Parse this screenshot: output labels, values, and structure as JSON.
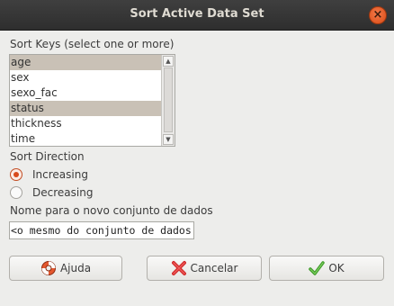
{
  "window": {
    "title": "Sort Active Data Set",
    "close_glyph": "×"
  },
  "sort_keys": {
    "label": "Sort Keys (select one or more)",
    "items": [
      {
        "label": "age",
        "selected": true
      },
      {
        "label": "sex",
        "selected": false
      },
      {
        "label": "sexo_fac",
        "selected": false
      },
      {
        "label": "status",
        "selected": true
      },
      {
        "label": "thickness",
        "selected": false
      },
      {
        "label": "time",
        "selected": false
      }
    ],
    "scroll_up_glyph": "▲",
    "scroll_down_glyph": "▼"
  },
  "direction": {
    "label": "Sort Direction",
    "options": [
      {
        "label": "Increasing",
        "checked": true
      },
      {
        "label": "Decreasing",
        "checked": false
      }
    ]
  },
  "new_dataset": {
    "label": "Nome para o novo conjunto de dados",
    "value": "<o mesmo do conjunto de dados"
  },
  "buttons": {
    "help": {
      "label": "Ajuda",
      "icon": "help-lifebuoy-icon"
    },
    "cancel": {
      "label": "Cancelar",
      "icon": "red-x-icon"
    },
    "ok": {
      "label": "OK",
      "icon": "green-check-icon"
    }
  },
  "colors": {
    "accent": "#d84a1c",
    "selection": "#c9c1b6",
    "titlebar": "#353535"
  }
}
